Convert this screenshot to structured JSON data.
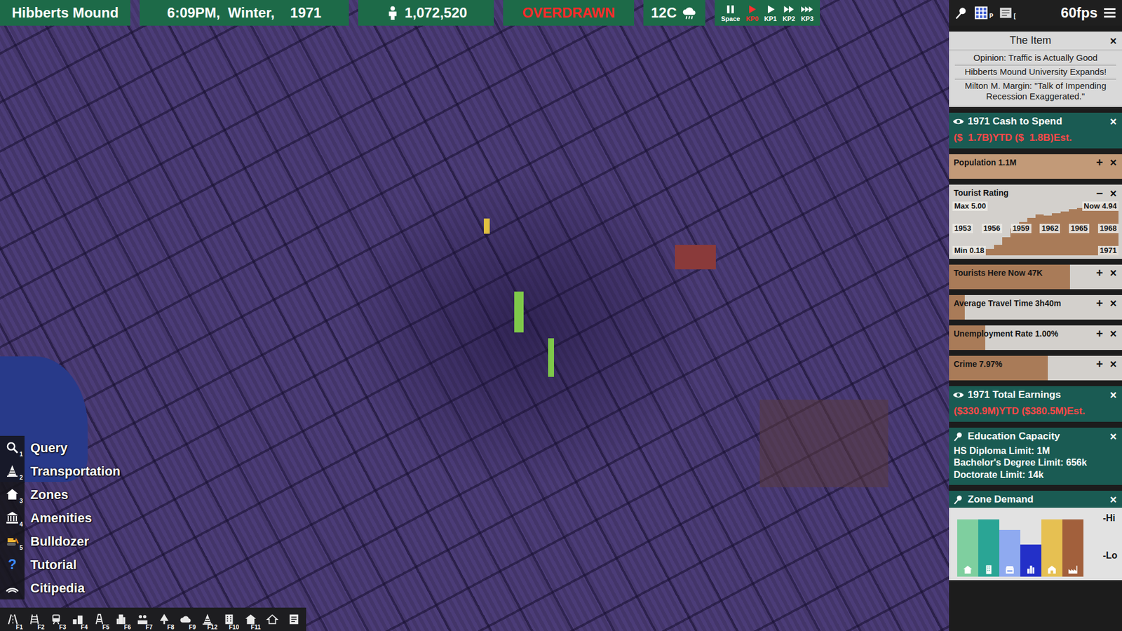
{
  "top_bar": {
    "city": "Hibberts Mound",
    "datetime": "6:09PM,  Winter,    1971",
    "population": "1,072,520",
    "status": "OVERDRAWN",
    "temperature": "12C",
    "speed_buttons": [
      {
        "label": "Space",
        "kind": "pause",
        "selected": false
      },
      {
        "label": "KP0",
        "kind": "play",
        "selected": true
      },
      {
        "label": "KP1",
        "kind": "play",
        "selected": false
      },
      {
        "label": "KP2",
        "kind": "fast",
        "selected": false
      },
      {
        "label": "KP3",
        "kind": "fastest",
        "selected": false
      }
    ],
    "tools": [
      {
        "kind": "pin",
        "key": ""
      },
      {
        "kind": "grid",
        "key": "P"
      },
      {
        "kind": "news",
        "key": "["
      }
    ],
    "fps": "60fps"
  },
  "panels": [
    {
      "kind": "news",
      "title": "The Item",
      "close": "×",
      "headlines": [
        "Opinion: Traffic is Actually Good",
        "Hibberts Mound University Expands!",
        "Milton M. Margin: \"Talk of Impending Recession Exaggerated.\""
      ]
    },
    {
      "kind": "money",
      "title": "1971 Cash to Spend",
      "pinned": false,
      "close": "×",
      "value": "($  1.7B)YTD ($  1.8B)Est."
    },
    {
      "kind": "stat",
      "label": "Population 1.1M",
      "level": 1.0,
      "toggle": "+",
      "close": "×"
    },
    {
      "kind": "chart",
      "title": "Tourist Rating",
      "toggle": "−",
      "close": "×",
      "max_label": "Max",
      "max": "5.00",
      "now_label": "Now",
      "now": "4.94",
      "min_label": "Min",
      "min": "0.18",
      "years": [
        "1953",
        "1956",
        "1959",
        "1962",
        "1965",
        "1968"
      ],
      "last_year": "1971",
      "values": [
        0.18,
        0.2,
        0.25,
        0.35,
        0.6,
        1.0,
        1.7,
        2.5,
        3.1,
        3.5,
        3.8,
        3.7,
        3.9,
        4.1,
        4.3,
        4.4,
        4.6,
        4.8,
        4.9,
        4.94
      ]
    },
    {
      "kind": "stat",
      "label": "Tourists Here Now 47K",
      "level": 0.7,
      "toggle": "+",
      "close": "×"
    },
    {
      "kind": "stat",
      "label": "Average Travel Time 3h40m",
      "level": 0.09,
      "toggle": "+",
      "close": "×"
    },
    {
      "kind": "stat",
      "label": "Unemployment Rate 1.00%",
      "level": 0.21,
      "toggle": "+",
      "close": "×"
    },
    {
      "kind": "stat",
      "label": "Crime 7.97%",
      "level": 0.57,
      "toggle": "+",
      "close": "×"
    },
    {
      "kind": "money",
      "title": "1971 Total Earnings",
      "pinned": false,
      "close": "×",
      "value": "($330.9M)YTD ($380.5M)Est."
    },
    {
      "kind": "list",
      "title": "Education Capacity",
      "pinned": true,
      "close": "×",
      "lines": [
        "HS Diploma Limit: 1M",
        "Bachelor's Degree Limit: 656k",
        "Doctorate Limit: 14k"
      ]
    },
    {
      "kind": "demand",
      "title": "Zone Demand",
      "pinned": true,
      "close": "×",
      "hi": "-Hi",
      "lo": "-Lo",
      "bars": [
        {
          "kind": "house",
          "level": 0.85,
          "color": "#7fcf9f"
        },
        {
          "kind": "apartment",
          "level": 0.85,
          "color": "#2aa595"
        },
        {
          "kind": "retail",
          "level": 0.64,
          "color": "#8faaf0"
        },
        {
          "kind": "office",
          "level": 0.36,
          "color": "#2330c8"
        },
        {
          "kind": "farm",
          "level": 0.85,
          "color": "#e6c052"
        },
        {
          "kind": "industry",
          "level": 0.85,
          "color": "#a2603c"
        }
      ]
    }
  ],
  "left_menu": [
    {
      "label": "Query",
      "key": "1",
      "kind": "query",
      "glyph": ""
    },
    {
      "label": "Transportation",
      "key": "2",
      "kind": "cone",
      "glyph": ""
    },
    {
      "label": "Zones",
      "key": "3",
      "kind": "house",
      "glyph": ""
    },
    {
      "label": "Amenities",
      "key": "4",
      "kind": "museum",
      "glyph": ""
    },
    {
      "label": "Bulldozer",
      "key": "5",
      "kind": "bulldozer",
      "glyph": ""
    },
    {
      "label": "Tutorial",
      "key": "",
      "kind": "tutorial",
      "glyph": "?"
    },
    {
      "label": "Citipedia",
      "key": "",
      "kind": "citipedia",
      "glyph": ""
    }
  ],
  "toolbar": [
    {
      "key": "F1",
      "kind": "road"
    },
    {
      "key": "F2",
      "kind": "rail"
    },
    {
      "key": "F3",
      "kind": "transit"
    },
    {
      "key": "F4",
      "kind": "zone"
    },
    {
      "key": "F5",
      "kind": "power"
    },
    {
      "key": "F6",
      "kind": "tower"
    },
    {
      "key": "F7",
      "kind": "people"
    },
    {
      "key": "F8",
      "kind": "tree"
    },
    {
      "key": "F9",
      "kind": "cloud"
    },
    {
      "key": "F12",
      "kind": "cone"
    },
    {
      "key": "F10",
      "kind": "building"
    },
    {
      "key": "F11",
      "kind": "house"
    },
    {
      "key": "",
      "kind": "house2"
    },
    {
      "key": "",
      "kind": "notes"
    }
  ]
}
